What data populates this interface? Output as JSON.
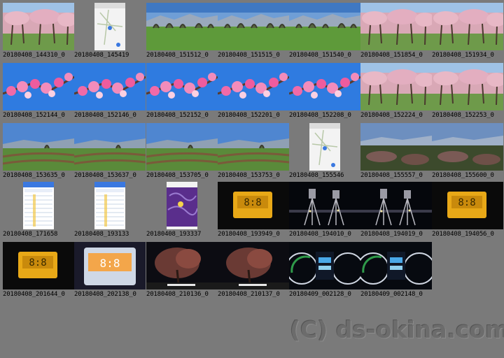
{
  "thumbnails": [
    {
      "label": "20180408_144310_0",
      "scene": "orchard-blossom"
    },
    {
      "label": "20180408_145419",
      "scene": "phone-map"
    },
    {
      "label": "20180408_151512_0",
      "scene": "field-trees"
    },
    {
      "label": "20180408_151515_0",
      "scene": "field-trees"
    },
    {
      "label": "20180408_151540_0",
      "scene": "field-trees"
    },
    {
      "label": "20180408_151854_0",
      "scene": "orchard-blossom"
    },
    {
      "label": "20180408_151934_0",
      "scene": "orchard-blossom"
    },
    {
      "label": "20180408_152144_0",
      "scene": "blossom-sky"
    },
    {
      "label": "20180408_152146_0",
      "scene": "blossom-sky"
    },
    {
      "label": "20180408_152152_0",
      "scene": "blossom-sky"
    },
    {
      "label": "20180408_152201_0",
      "scene": "blossom-sky"
    },
    {
      "label": "20180408_152208_0",
      "scene": "blossom-sky"
    },
    {
      "label": "20180408_152224_0",
      "scene": "orchard-blossom"
    },
    {
      "label": "20180408_152253_0",
      "scene": "orchard-blossom"
    },
    {
      "label": "20180408_153635_0",
      "scene": "field-rows"
    },
    {
      "label": "20180408_153637_0",
      "scene": "field-rows"
    },
    {
      "label": "20180408_153705_0",
      "scene": "field-rows"
    },
    {
      "label": "20180408_153753_0",
      "scene": "field-rows"
    },
    {
      "label": "20180408_155546",
      "scene": "phone-map"
    },
    {
      "label": "20180408_155557_0",
      "scene": "valley-dusk"
    },
    {
      "label": "20180408_155600_0",
      "scene": "valley-dusk"
    },
    {
      "label": "20180408_171658",
      "scene": "phone-table"
    },
    {
      "label": "20180408_193133",
      "scene": "phone-table"
    },
    {
      "label": "20180408_193337",
      "scene": "phone-purple"
    },
    {
      "label": "20180408_193949_0",
      "scene": "clock"
    },
    {
      "label": "20180408_194010_0",
      "scene": "tripod-night"
    },
    {
      "label": "20180408_194019_0",
      "scene": "tripod-night"
    },
    {
      "label": "20180408_194056_0",
      "scene": "clock"
    },
    {
      "label": "20180408_201644_0",
      "scene": "clock"
    },
    {
      "label": "20180408_202138_0",
      "scene": "clock-bright"
    },
    {
      "label": "20180408_210136_0",
      "scene": "night-tree"
    },
    {
      "label": "20180408_210137_0",
      "scene": "night-tree"
    },
    {
      "label": "20180409_002128_0",
      "scene": "dashboard"
    },
    {
      "label": "20180409_002148_0",
      "scene": "dashboard"
    }
  ],
  "watermark": "(C) ds-okina.com",
  "colors": {
    "background": "#7a7a7a",
    "caption": "#000000",
    "watermark": "#6c6c6c"
  }
}
